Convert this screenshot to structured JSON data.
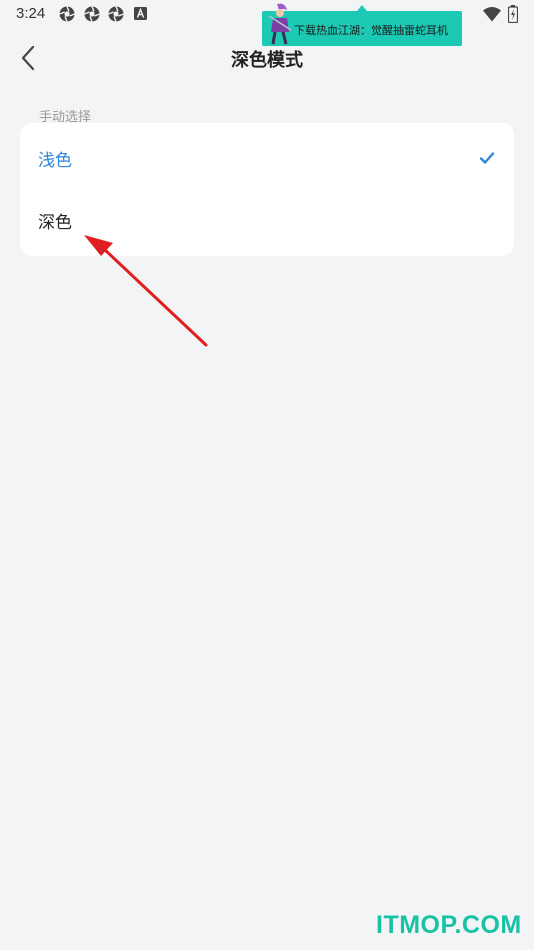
{
  "status_bar": {
    "time": "3:24",
    "notification_icons": [
      "aperture-icon",
      "aperture-icon",
      "aperture-icon",
      "a-badge-icon"
    ]
  },
  "ad": {
    "text": "下载热血江湖：觉醒抽雷蛇耳机",
    "color": "#1cc9b4"
  },
  "header": {
    "title": "深色模式",
    "back_icon": "chevron-left-icon"
  },
  "section": {
    "label": "手动选择"
  },
  "options": [
    {
      "label": "浅色",
      "selected": true,
      "color": "#2e86d8"
    },
    {
      "label": "深色",
      "selected": false,
      "color": "#222222"
    }
  ],
  "annotation": {
    "color": "#e02020"
  },
  "watermark": {
    "text": "ITMOP.COM",
    "color": "#19c2a6"
  }
}
